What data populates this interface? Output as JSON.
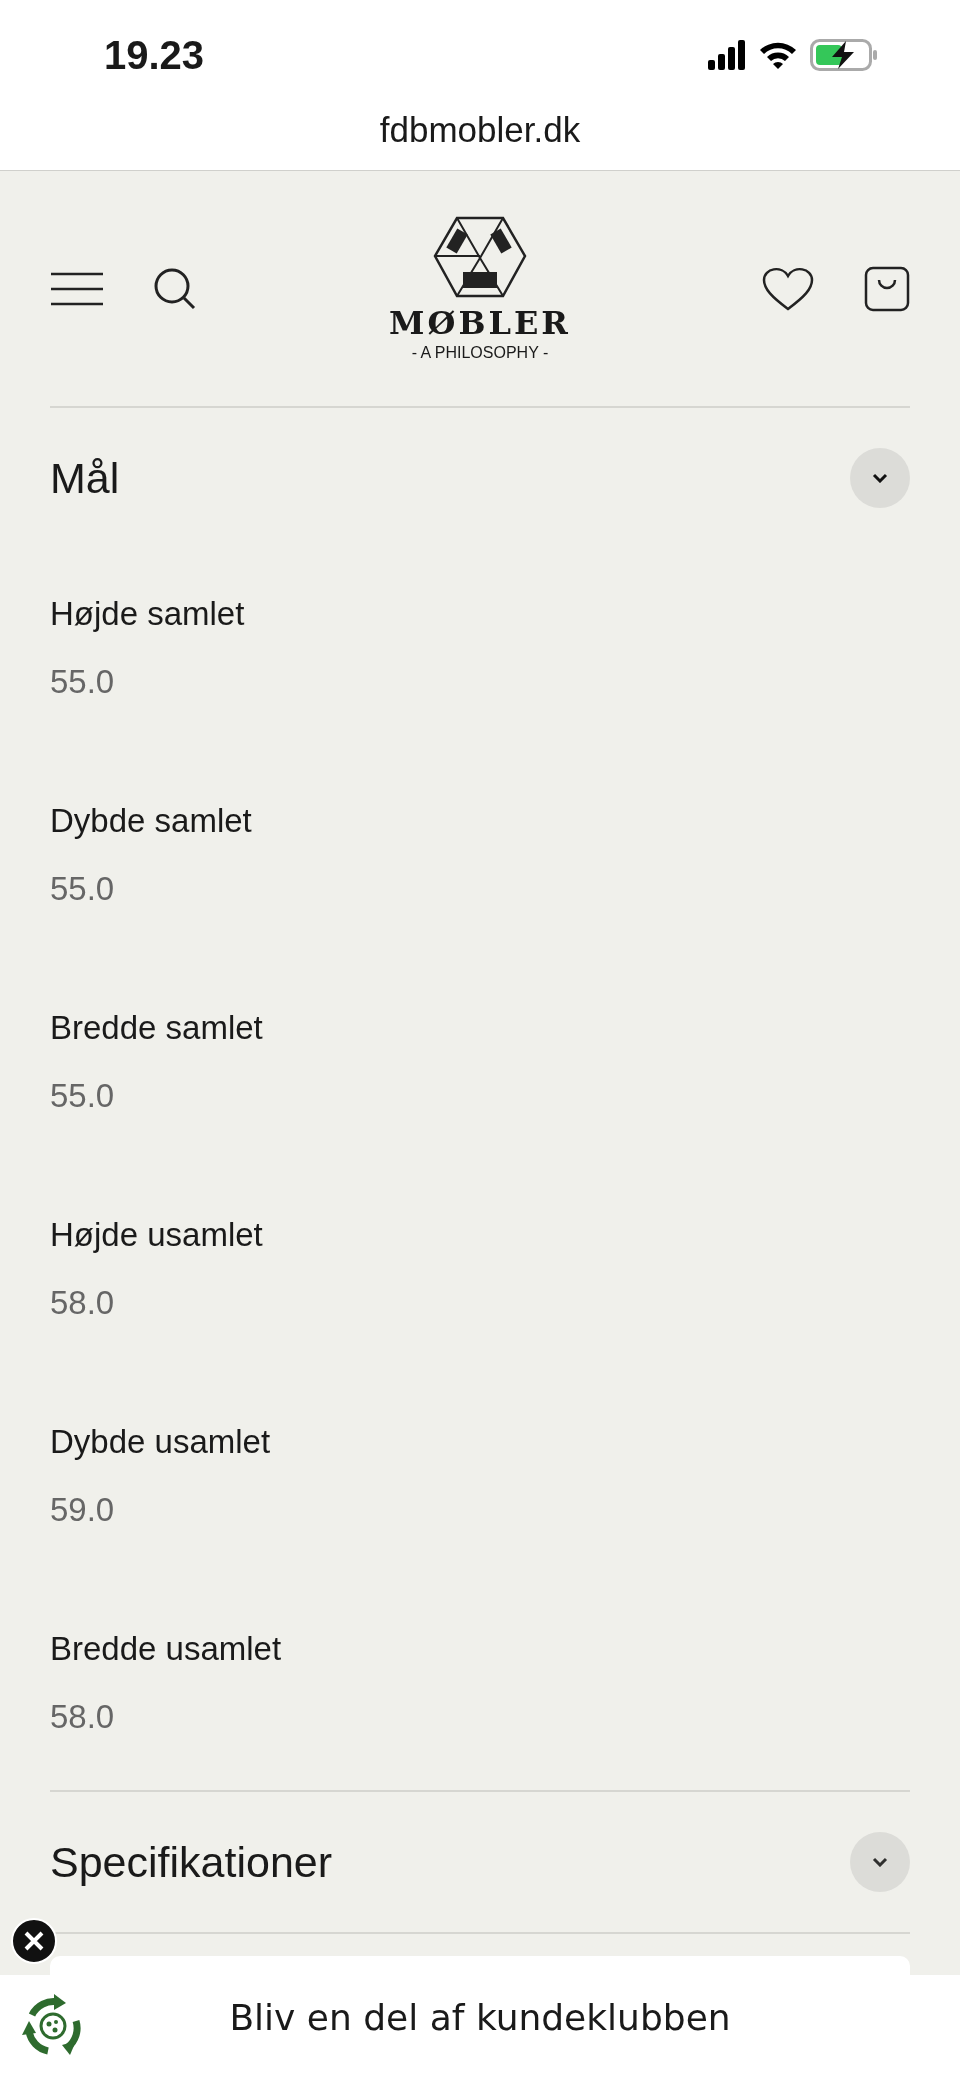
{
  "status_bar": {
    "time": "19.23"
  },
  "browser": {
    "url": "fdbmobler.dk"
  },
  "header": {
    "logo_wordmark": "MØBLER",
    "logo_tagline": "- A PHILOSOPHY -"
  },
  "sections": [
    {
      "title": "Mål",
      "expanded": true,
      "items": [
        {
          "label": "Højde samlet",
          "value": "55.0"
        },
        {
          "label": "Dybde samlet",
          "value": "55.0"
        },
        {
          "label": "Bredde samlet",
          "value": "55.0"
        },
        {
          "label": "Højde usamlet",
          "value": "58.0"
        },
        {
          "label": "Dybde usamlet",
          "value": "59.0"
        },
        {
          "label": "Bredde usamlet",
          "value": "58.0"
        }
      ]
    },
    {
      "title": "Specifikationer",
      "expanded": false
    }
  ],
  "club_banner": {
    "text": "Bliv en del af kundeklubben"
  }
}
